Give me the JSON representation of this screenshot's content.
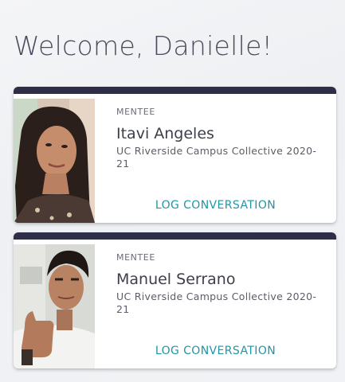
{
  "header": {
    "welcome": "Welcome, Danielle!"
  },
  "mentees": [
    {
      "role": "MENTEE",
      "name": "Itavi Angeles",
      "program": "UC Riverside Campus Collective 2020-21",
      "action_label": "LOG CONVERSATION"
    },
    {
      "role": "MENTEE",
      "name": "Manuel Serrano",
      "program": "UC Riverside Campus Collective 2020-21",
      "action_label": "LOG CONVERSATION"
    }
  ],
  "colors": {
    "card_bar": "#2f2e48",
    "action": "#1f96a6",
    "heading": "#4a4c5e"
  }
}
